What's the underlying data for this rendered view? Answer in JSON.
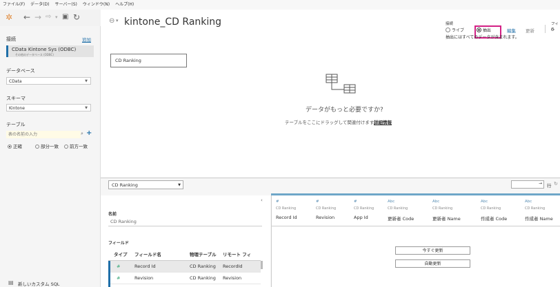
{
  "menu": [
    "ファイル(F)",
    "データ(D)",
    "サーバー(S)",
    "ウィンドウ(N)",
    "ヘルプ(H)"
  ],
  "sidebar": {
    "connections_title": "接続",
    "add_link": "追加",
    "connection_name": "CData Kintone Sys (ODBC)",
    "connection_sub": "その他のデータベース (ODBC)",
    "database_title": "データベース",
    "database_value": "CData",
    "schema_title": "スキーマ",
    "schema_value": "Kintone",
    "table_title": "テーブル",
    "table_search_placeholder": "表の名前の入力",
    "match_options": [
      "正確",
      "部分一致",
      "前方一致"
    ],
    "new_custom_sql": "新しいカスタム SQL"
  },
  "canvas": {
    "title": "kintone_CD Ranking",
    "connection_label": "接続",
    "live": "ライブ",
    "extract": "抽出",
    "edit": "編集",
    "refresh": "更新",
    "extract_note": "抽出にはすべてのデータが含まれます。",
    "filter_label": "フィル",
    "filter_count": "0",
    "table_box": "CD Ranking",
    "need_more": "データがもっと必要ですか?",
    "drag_hint": "テーブルをここにドラッグして関連付けます。",
    "details_link": "詳細情報"
  },
  "bottom": {
    "table_select": "CD Ranking",
    "rows_label": "行",
    "meta_name_label": "名前",
    "meta_name_value": "CD Ranking",
    "fields_label": "フィールド",
    "field_headers": [
      "タイプ",
      "フィールド名",
      "物理テーブル",
      "リモート フィー..."
    ],
    "fields": [
      {
        "type": "#",
        "name": "Record Id",
        "table": "CD Ranking",
        "remote": "RecordId"
      },
      {
        "type": "#",
        "name": "Revision",
        "table": "CD Ranking",
        "remote": "Revision"
      }
    ],
    "columns": [
      {
        "type": "#",
        "source": "CD Ranking",
        "name": "Record Id"
      },
      {
        "type": "#",
        "source": "CD Ranking",
        "name": "Revision"
      },
      {
        "type": "#",
        "source": "CD Ranking",
        "name": "App Id"
      },
      {
        "type": "Abc",
        "source": "CD Ranking",
        "name": "更新者 Code"
      },
      {
        "type": "Abc",
        "source": "CD Ranking",
        "name": "更新者 Name"
      },
      {
        "type": "Abc",
        "source": "CD Ranking",
        "name": "作成者 Code"
      },
      {
        "type": "Abc",
        "source": "CD Ranking",
        "name": "作成者 Name"
      }
    ],
    "update_now": "今すぐ更新",
    "auto_update": "自動更新"
  }
}
